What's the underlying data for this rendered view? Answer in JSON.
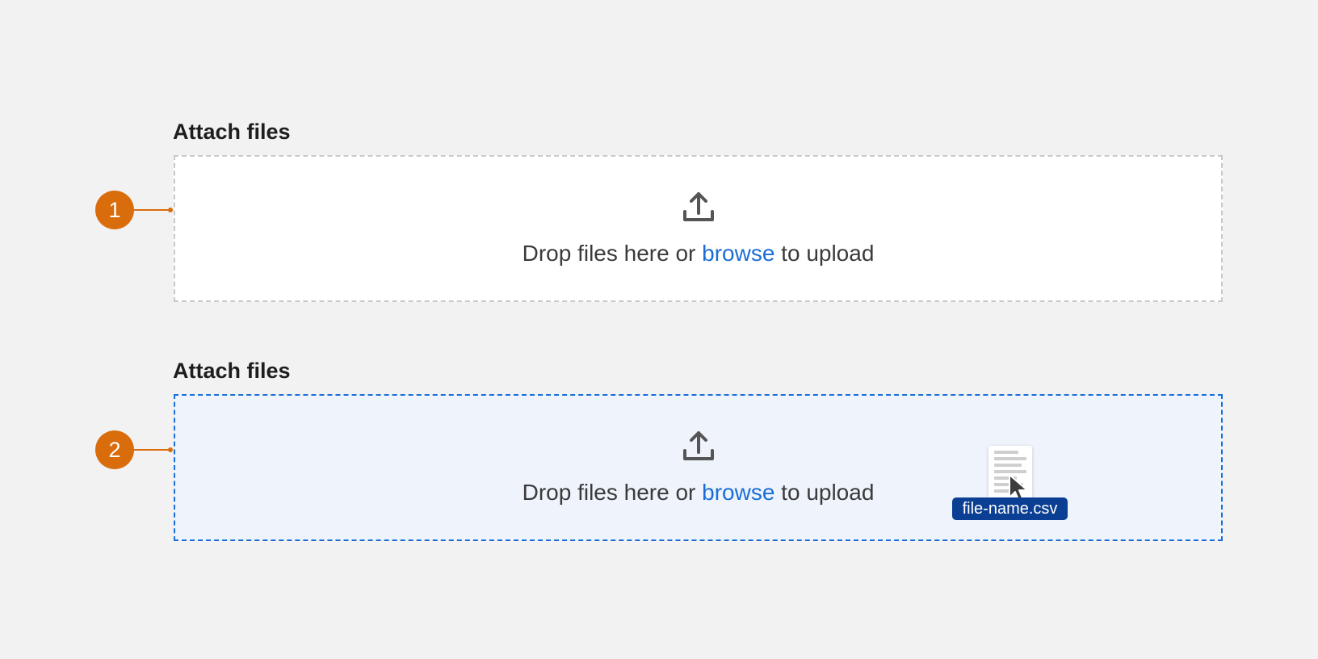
{
  "colors": {
    "page_background": "#f2f2f2",
    "callout": "#d96d0c",
    "link": "#1b6ed6",
    "active_border": "#1b6ed6",
    "active_background": "#eef3fc",
    "idle_border": "#c9c9c9",
    "file_chip": "#0b3f93"
  },
  "callouts": [
    {
      "number": "1"
    },
    {
      "number": "2"
    }
  ],
  "uploaders": [
    {
      "label": "Attach files",
      "state": "default",
      "icon": "upload-icon",
      "text_before": "Drop files here or ",
      "link_text": "browse",
      "text_after": " to upload"
    },
    {
      "label": "Attach files",
      "state": "drag-over",
      "icon": "upload-icon",
      "text_before": "Drop files here or ",
      "link_text": "browse",
      "text_after": " to upload"
    }
  ],
  "dragged_file": {
    "name": "file-name.csv",
    "icon": "document-icon",
    "cursor": "cursor-arrow-icon"
  }
}
